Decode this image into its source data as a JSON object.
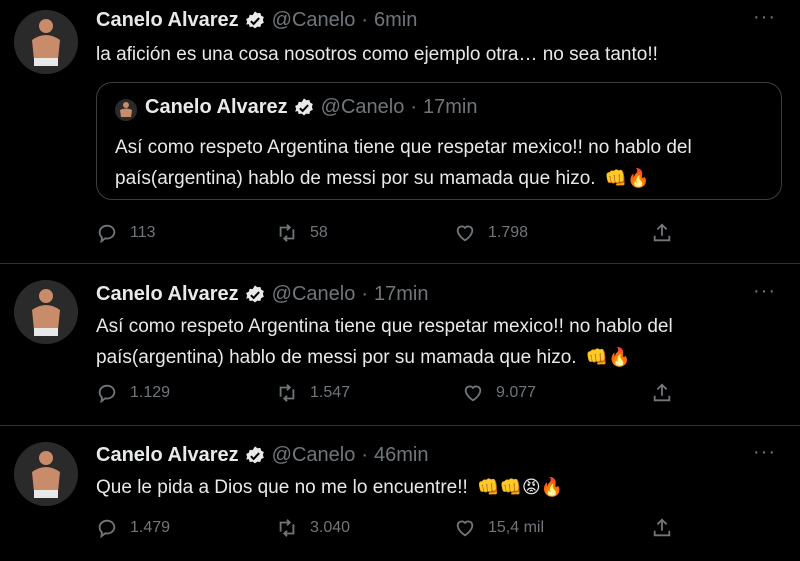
{
  "tweets": [
    {
      "name": "Canelo Alvarez",
      "handle": "@Canelo",
      "dot": "·",
      "time": "6min",
      "text": "la afición es una cosa nosotros como ejemplo otra… no sea tanto!!",
      "quote": {
        "name": "Canelo Alvarez",
        "handle": "@Canelo",
        "dot": "·",
        "time": "17min",
        "text": "Así como respeto Argentina tiene que respetar mexico!! no hablo del país(argentina) hablo de messi por su mamada que hizo.",
        "emojis": "👊🔥"
      },
      "replies": "113",
      "retweets": "58",
      "likes": "1.798"
    },
    {
      "name": "Canelo Alvarez",
      "handle": "@Canelo",
      "dot": "·",
      "time": "17min",
      "text": "Así como respeto Argentina tiene que respetar mexico!! no hablo del país(argentina) hablo de messi por su mamada que hizo.",
      "emojis": "👊🔥",
      "replies": "1.129",
      "retweets": "1.547",
      "likes": "9.077"
    },
    {
      "name": "Canelo Alvarez",
      "handle": "@Canelo",
      "dot": "·",
      "time": "46min",
      "text": "Que le pida a Dios que no me lo encuentre!!",
      "emojis": "👊👊😡🔥",
      "replies": "1.479",
      "retweets": "3.040",
      "likes": "15,4 mil"
    }
  ],
  "icons": {
    "verified": "verified-badge-icon",
    "more": "more-options-icon",
    "reply": "reply-icon",
    "retweet": "retweet-icon",
    "like": "like-icon",
    "share": "share-icon"
  },
  "colors": {
    "background": "#000000",
    "text": "#e7e9ea",
    "muted": "#71767b",
    "separator": "#2f3336"
  },
  "more_label": "···"
}
